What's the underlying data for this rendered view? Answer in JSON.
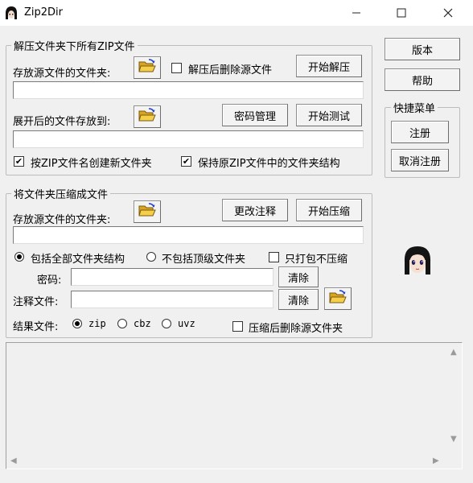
{
  "window": {
    "title": "Zip2Dir"
  },
  "extract": {
    "group_title": "解压文件夹下所有ZIP文件",
    "source_label": "存放源文件的文件夹:",
    "delete_after_label": "解压后删除源文件",
    "start_extract": "开始解压",
    "source_value": "",
    "dest_label": "展开后的文件存放到:",
    "password_manage": "密码管理",
    "start_test": "开始测试",
    "dest_value": "",
    "create_folder_label": "按ZIP文件名创建新文件夹",
    "create_folder_checked": true,
    "keep_structure_label": "保持原ZIP文件中的文件夹结构",
    "keep_structure_checked": true,
    "delete_after_checked": false
  },
  "compress": {
    "group_title": "将文件夹压缩成文件",
    "source_label": "存放源文件的文件夹:",
    "change_comment": "更改注释",
    "start_compress": "开始压缩",
    "source_value": "",
    "opt_all_structure": "包括全部文件夹结构",
    "opt_no_top": "不包括顶级文件夹",
    "store_only_label": "只打包不压缩",
    "selected_structure": "all",
    "password_label": "密码:",
    "password_value": "",
    "clear_label": "清除",
    "comment_label": "注释文件:",
    "comment_value": "",
    "result_label": "结果文件:",
    "formats": [
      "zip",
      "cbz",
      "uvz"
    ],
    "selected_format": "zip",
    "delete_after_label": "压缩后删除源文件夹",
    "delete_after_checked": false,
    "store_only_checked": false
  },
  "side": {
    "version": "版本",
    "help": "帮助",
    "quick_menu_title": "快捷菜单",
    "register": "注册",
    "unregister": "取消注册"
  },
  "log": {
    "content": ""
  }
}
